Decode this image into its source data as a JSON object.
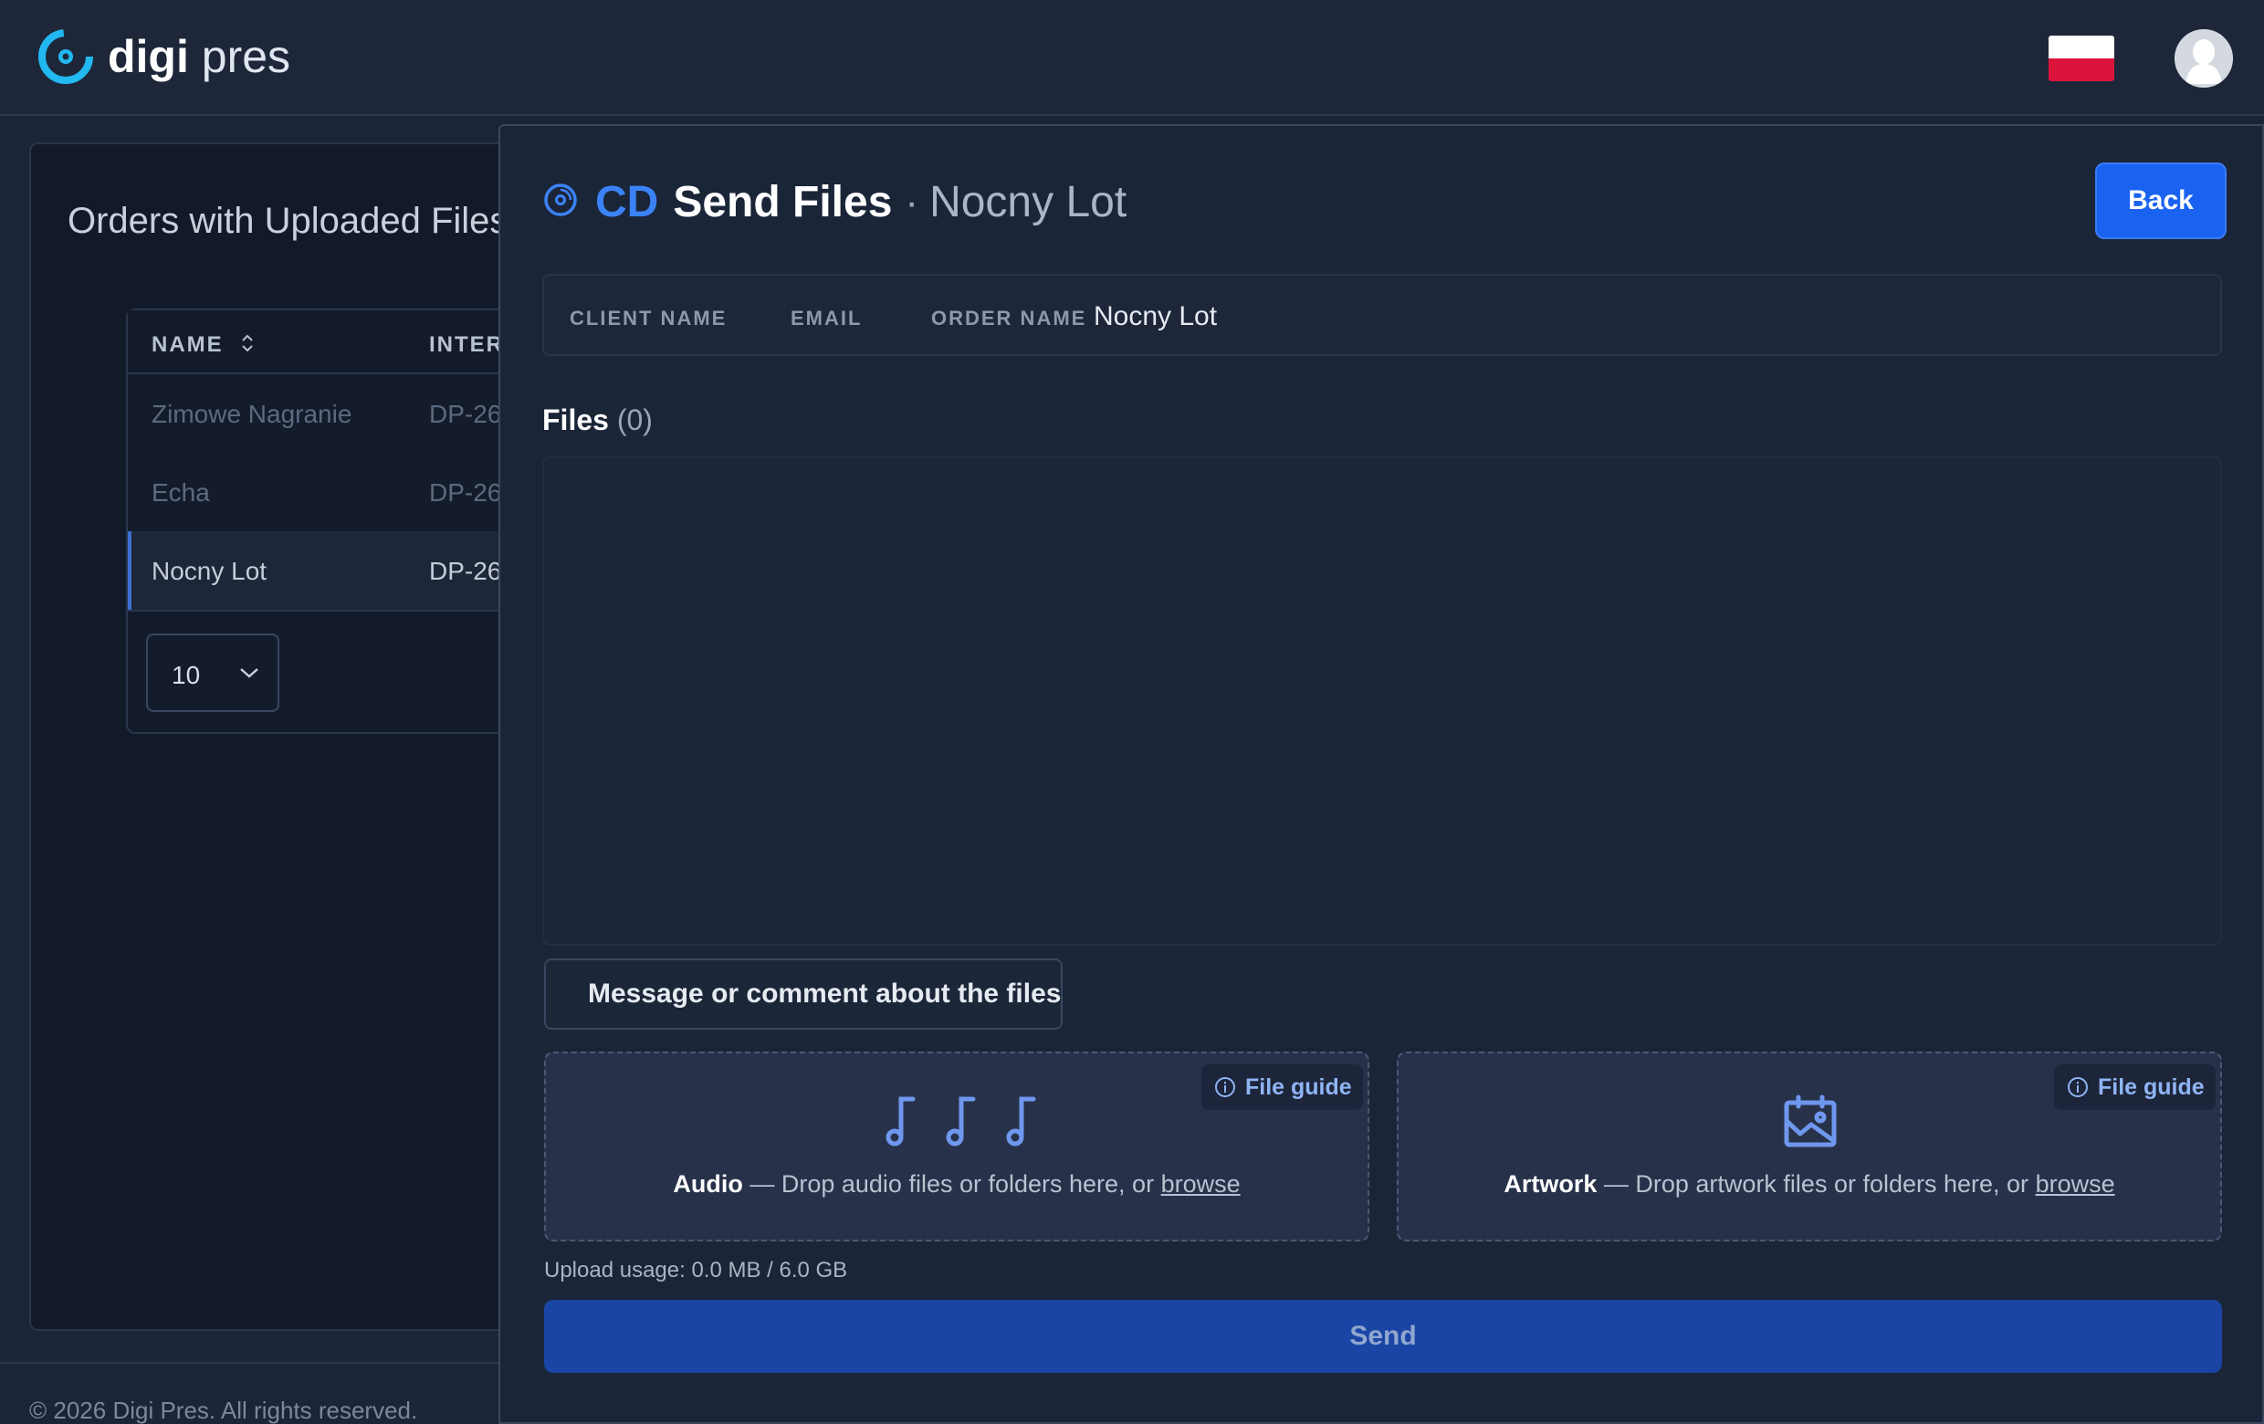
{
  "app": {
    "logo_bold": "digi",
    "logo_light": " pres",
    "language_flag": "poland-flag"
  },
  "background_page": {
    "title": "Orders with Uploaded Files",
    "columns": [
      "NAME",
      "INTER"
    ],
    "rows": [
      {
        "name": "Zimowe Nagranie",
        "internal": "DP-26"
      },
      {
        "name": "Echa",
        "internal": "DP-26"
      },
      {
        "name": "Nocny Lot",
        "internal": "DP-26",
        "selected": true
      }
    ],
    "page_size": "10",
    "footer": "© 2026 Digi Pres. All rights reserved."
  },
  "modal": {
    "format": "CD",
    "title": "Send Files",
    "separator": "·",
    "order_title": "Nocny Lot",
    "back_label": "Back",
    "info": {
      "client_name_label": "CLIENT NAME",
      "client_name_value": "",
      "email_label": "EMAIL",
      "email_value": "",
      "order_name_label": "ORDER NAME",
      "order_name_value": "Nocny Lot"
    },
    "files_label": "Files",
    "files_count": "(0)",
    "message_label": "Message or comment about the files",
    "audio": {
      "guide_label": "File guide",
      "kind": "Audio",
      "text": " — Drop audio files or folders here, or ",
      "browse": "browse"
    },
    "artwork": {
      "guide_label": "File guide",
      "kind": "Artwork",
      "text": " — Drop artwork files or folders here, or ",
      "browse": "browse"
    },
    "usage": "Upload usage: 0.0 MB / 6.0 GB",
    "send_label": "Send"
  },
  "colors": {
    "accent": "#1a63f0",
    "cd_blue": "#3b82f6",
    "send_disabled": "#1a45a5",
    "background": "#1b2538"
  }
}
